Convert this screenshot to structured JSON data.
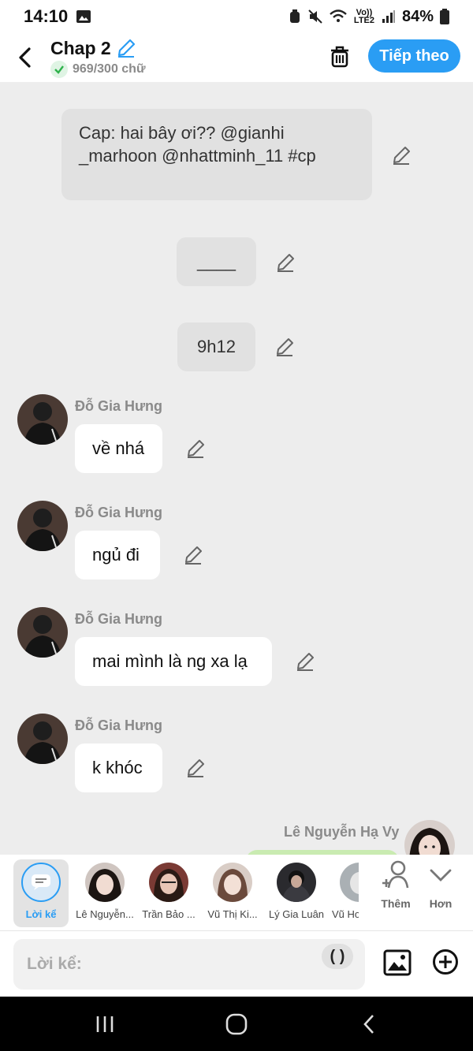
{
  "status_bar": {
    "time": "14:10",
    "battery": "84%",
    "network": "Vo)) LTE2"
  },
  "header": {
    "title": "Chap 2",
    "counter": "969/300 chữ",
    "next_label": "Tiếp theo"
  },
  "messages": {
    "caption": "Cap: hai bây ơi?? @gianhi _marhoon @nhattminh_11 #cp",
    "divider": "____",
    "time_note": "9h12",
    "sender": "Đỗ Gia Hưng",
    "m1": "về nhá",
    "m2": "ngủ đi",
    "m3": "mai mình là ng xa lạ",
    "m4": "k khóc",
    "right_sender": "Lê Nguyễn Hạ Vy"
  },
  "characters": {
    "narrator": "Lời kể",
    "c1": "Lê Nguyễn...",
    "c2": "Trần Bảo ...",
    "c3": "Vũ Thị Ki...",
    "c4": "Lý Gia Luân",
    "c5": "Vũ Ho",
    "add_label": "Thêm",
    "more_label": "Hơn"
  },
  "input": {
    "placeholder": "Lời kể:",
    "paren": "( )"
  },
  "colors": {
    "accent": "#2a9df4",
    "green_bubble": "#c9ebb1",
    "header_bg": "#ffffff",
    "chat_bg": "#ededed"
  }
}
